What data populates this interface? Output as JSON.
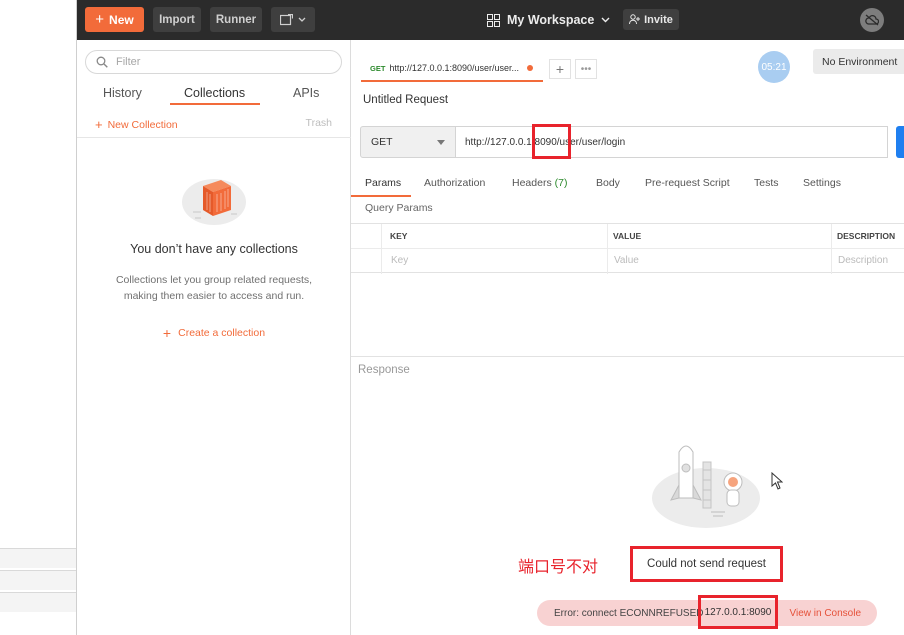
{
  "header": {
    "new_label": "New",
    "import_label": "Import",
    "runner_label": "Runner",
    "workspace_label": "My Workspace",
    "invite_label": "Invite"
  },
  "sidebar": {
    "filter_placeholder": "Filter",
    "tabs": [
      {
        "label": "History",
        "active": false
      },
      {
        "label": "Collections",
        "active": true
      },
      {
        "label": "APIs",
        "active": false
      }
    ],
    "new_collection_label": "New Collection",
    "trash_label": "Trash",
    "empty_title": "You don’t have any collections",
    "empty_desc_line1": "Collections let you group related requests,",
    "empty_desc_line2": "making them easier to access and run.",
    "create_label": "Create a collection"
  },
  "request_tab": {
    "method": "GET",
    "title": "http://127.0.0.1:8090/user/user..."
  },
  "timer": "05:21",
  "environment": "No Environment",
  "request": {
    "title": "Untitled Request",
    "method": "GET",
    "url_part1": "http://127.0.0.",
    "url_part2": "1:8090/",
    "url_part3": "user/user/login"
  },
  "subtabs": [
    {
      "label": "Params",
      "active": true
    },
    {
      "label": "Authorization"
    },
    {
      "label": "Headers",
      "count": "(7)"
    },
    {
      "label": "Body"
    },
    {
      "label": "Pre-request Script"
    },
    {
      "label": "Tests"
    },
    {
      "label": "Settings"
    }
  ],
  "query_params": {
    "title": "Query Params",
    "headers": [
      "KEY",
      "VALUE",
      "DESCRIPTION"
    ],
    "placeholders": [
      "Key",
      "Value",
      "Description"
    ]
  },
  "response": {
    "title": "Response",
    "error_note_cn": "端口号不对",
    "error_message": "Could not send request",
    "error_detail": "Error: connect ECONNREFUSED",
    "error_host": "127.0.0.1:8090",
    "view_console_label": "View in Console"
  },
  "colors": {
    "accent": "#f26b3a",
    "header_bg": "#2b2b2b",
    "annotation_red": "#e8232c",
    "send_blue": "#1f7ff0"
  }
}
